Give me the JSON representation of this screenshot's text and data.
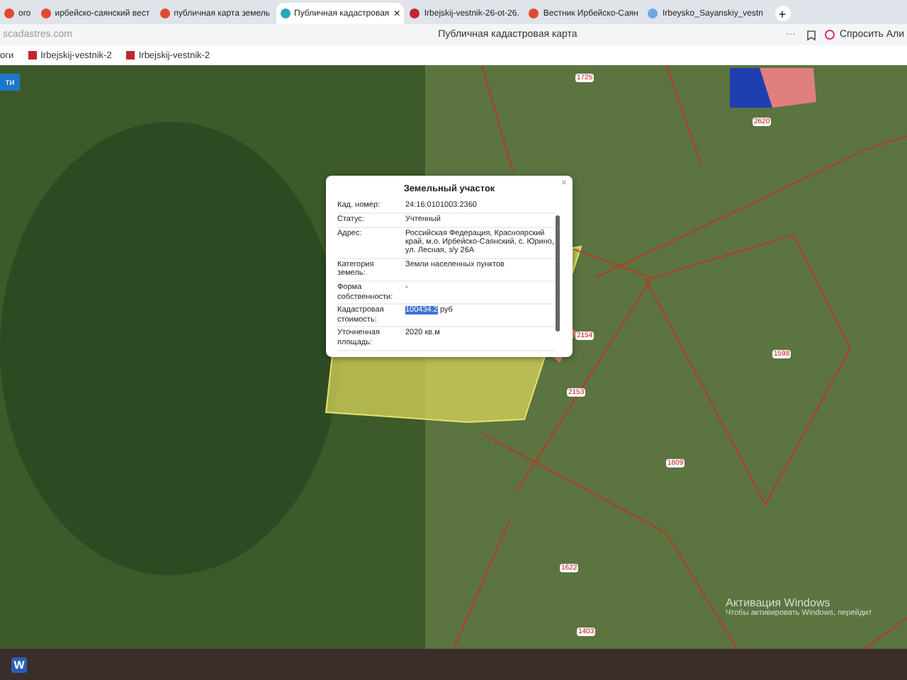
{
  "browser": {
    "tabs": [
      {
        "label": "ого",
        "selected": false
      },
      {
        "label": "ирбейско-саянский вест",
        "selected": false
      },
      {
        "label": "публичная карта земель",
        "selected": false
      },
      {
        "label": "Публичная кадастровая",
        "selected": true
      },
      {
        "label": "Irbejskij-vestnik-26-ot-26.",
        "selected": false
      },
      {
        "label": "Вестник Ирбейско-Саян",
        "selected": false
      },
      {
        "label": "Irbeysko_Sayanskiy_vestn",
        "selected": false
      }
    ],
    "new_tab": "+",
    "close_tab": "×",
    "address": "scadastres.com",
    "page_title": "Публичная кадастровая карта",
    "more": "···",
    "assistant": "Спросить Али",
    "bookmarks": [
      "оги",
      "Irbejskij-vestnik-2",
      "Irbejskij-vestnik-2"
    ]
  },
  "map": {
    "side_button": "ти",
    "parcel_labels": [
      {
        "text": "1725"
      },
      {
        "text": "2620"
      },
      {
        "text": "2154"
      },
      {
        "text": "2153"
      },
      {
        "text": "1598"
      },
      {
        "text": "1609"
      },
      {
        "text": "1622"
      },
      {
        "text": "1403"
      }
    ],
    "popup": {
      "title": "Земельный участок",
      "close": "×",
      "rows": [
        {
          "label": "Кад. номер:",
          "value": "24:16:0101003:2360"
        },
        {
          "label": "Статус:",
          "value": "Учтенный"
        },
        {
          "label": "Адрес:",
          "value": "Российская Федерация, Красноярский край, м.о. Ирбейско-Саянский, с. Юрино, ул. Лесная, з/у 26А"
        },
        {
          "label": "Категория земель:",
          "value": "Земли населенных пунктов"
        },
        {
          "label": "Форма собственности:",
          "value": "-"
        },
        {
          "label": "Кадастровая стоимость:",
          "value": "100434.2",
          "selected_text": true,
          "unit": "руб"
        },
        {
          "label": "Уточненная площадь:",
          "value": "2020 кв.м"
        }
      ]
    }
  },
  "taskbar": {
    "word_icon": "W"
  },
  "os_notice": {
    "title": "Активация Windows",
    "text": "Чтобы активировать Windows, перейдит"
  }
}
